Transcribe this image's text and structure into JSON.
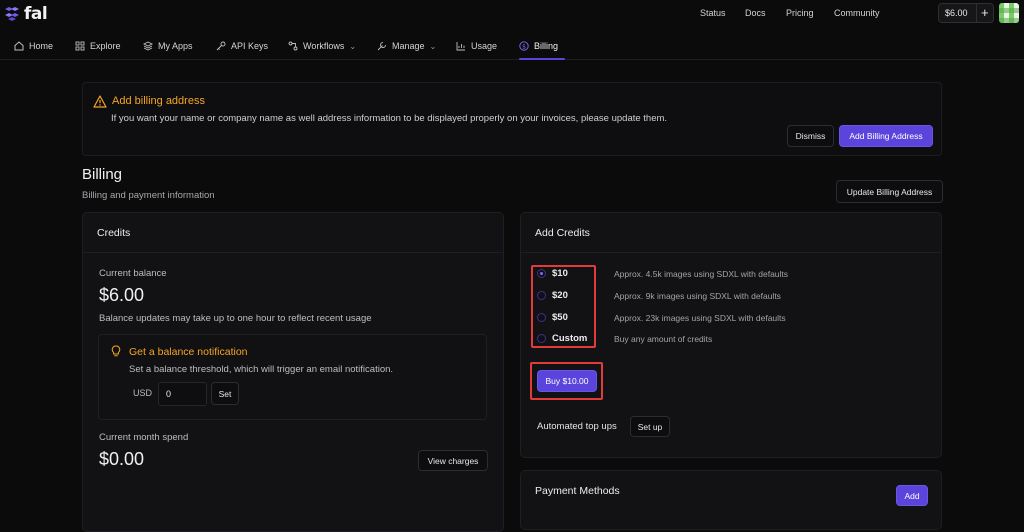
{
  "app": {
    "logo_text": "fal"
  },
  "topbar": {
    "links": [
      "Status",
      "Docs",
      "Pricing",
      "Community"
    ],
    "balance": "$6.00",
    "add_label": "+"
  },
  "nav": {
    "items": [
      {
        "label": "Home",
        "icon": "home-icon"
      },
      {
        "label": "Explore",
        "icon": "grid-icon"
      },
      {
        "label": "My Apps",
        "icon": "layers-icon"
      },
      {
        "label": "API Keys",
        "icon": "key-icon"
      },
      {
        "label": "Workflows",
        "icon": "workflow-icon",
        "chevron": "⌄"
      },
      {
        "label": "Manage",
        "icon": "wrench-icon",
        "chevron": "⌄"
      },
      {
        "label": "Usage",
        "icon": "chart-icon"
      },
      {
        "label": "Billing",
        "icon": "dollar-icon",
        "active": true
      }
    ]
  },
  "banner": {
    "title": "Add billing address",
    "text": "If you want your name or company name as well address information to be displayed properly on your invoices, please update them.",
    "dismiss_label": "Dismiss",
    "add_label": "Add Billing Address"
  },
  "billing": {
    "title": "Billing",
    "subtitle": "Billing and payment information",
    "update_label": "Update Billing Address"
  },
  "credits": {
    "title": "Credits",
    "current_balance_label": "Current balance",
    "current_balance": "$6.00",
    "balance_note": "Balance updates may take up to one hour to reflect recent usage",
    "notification": {
      "title": "Get a balance notification",
      "text": "Set a balance threshold, which will trigger an email notification.",
      "currency": "USD",
      "value": "0",
      "set_label": "Set"
    },
    "month_spend_label": "Current month spend",
    "month_spend": "$0.00",
    "view_charges_label": "View charges"
  },
  "add_credits": {
    "title": "Add Credits",
    "options": [
      {
        "label": "$10",
        "desc": "Approx. 4.5k images using SDXL with defaults",
        "selected": true
      },
      {
        "label": "$20",
        "desc": "Approx. 9k images using SDXL with defaults",
        "selected": false
      },
      {
        "label": "$50",
        "desc": "Approx. 23k images using SDXL with defaults",
        "selected": false
      },
      {
        "label": "Custom",
        "desc": "Buy any amount of credits",
        "selected": false
      }
    ],
    "buy_label": "Buy $10.00",
    "auto_topup_label": "Automated top ups",
    "setup_label": "Set up"
  },
  "payment_methods": {
    "title": "Payment Methods",
    "add_label": "Add"
  },
  "colors": {
    "accent": "#5b44db",
    "warning": "#f5a524",
    "highlight": "#e23b3b"
  }
}
